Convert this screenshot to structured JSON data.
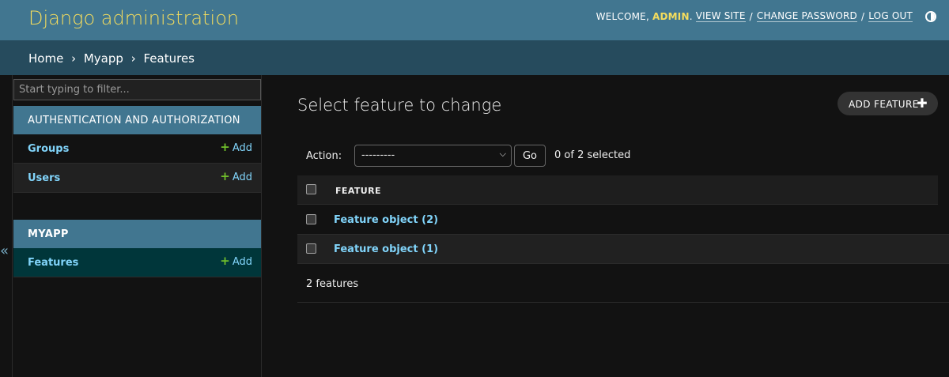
{
  "header": {
    "site_name": "Django administration",
    "welcome": "WELCOME,",
    "username": "ADMIN",
    "view_site": "VIEW SITE",
    "change_password": "CHANGE PASSWORD",
    "log_out": "LOG OUT",
    "separator": "/",
    "theme_icon": "half-circle-icon"
  },
  "breadcrumbs": {
    "home": "Home",
    "app": "Myapp",
    "current": "Features",
    "separator": "›"
  },
  "sidebar": {
    "collapse_glyph": "«",
    "filter_placeholder": "Start typing to filter...",
    "modules": [
      {
        "caption": "AUTHENTICATION AND AUTHORIZATION",
        "models": [
          {
            "name": "Groups",
            "add": "Add"
          },
          {
            "name": "Users",
            "add": "Add"
          }
        ]
      },
      {
        "caption": "MYAPP",
        "models": [
          {
            "name": "Features",
            "add": "Add",
            "current": true
          }
        ]
      }
    ]
  },
  "main": {
    "title": "Select feature to change",
    "add_button": "ADD FEATURE",
    "actions": {
      "label": "Action:",
      "selected_option": "---------",
      "go": "Go",
      "counter": "0 of 2 selected"
    },
    "table": {
      "column": "FEATURE",
      "rows": [
        "Feature object (2)",
        "Feature object (1)"
      ]
    },
    "paginator": "2 features"
  },
  "colors": {
    "header_bg": "#417690",
    "breadcrumb_bg": "#264b5d",
    "site_name": "#f5dd5d",
    "link": "#81d4fa",
    "add_plus": "#70bf2b",
    "body_bg": "#121212",
    "current_row": "#00363a"
  }
}
